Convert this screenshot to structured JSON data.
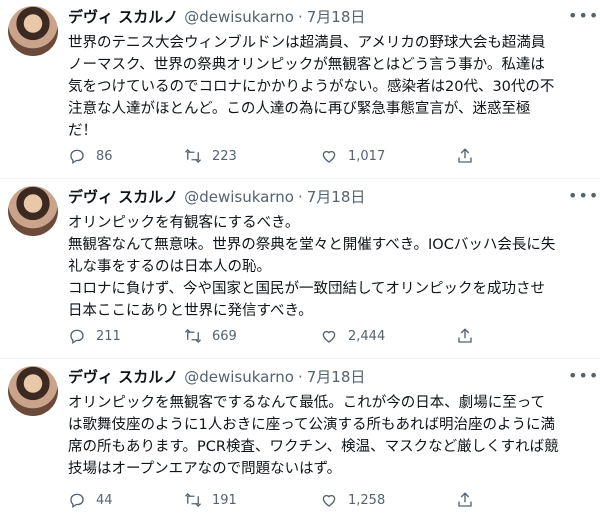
{
  "tweets": [
    {
      "name": "デヴィ スカルノ",
      "handle": "@dewisukarno",
      "separator": "·",
      "date": "7月18日",
      "lines": [
        "世界のテニス大会ウィンブルドンは超満員、アメリカの野球大会も超満員",
        "ノーマスク、世界の祭典オリンピックが無観客とはどう言う事か。私達は",
        "気をつけているのでコロナにかかりようがない。感染者は20代、30代の不",
        "注意な人達がほとんど。この人達の為に再び緊急事態宣言が、迷惑至極",
        "だ！"
      ],
      "replies": "86",
      "retweets": "223",
      "likes": "1,017"
    },
    {
      "name": "デヴィ スカルノ",
      "handle": "@dewisukarno",
      "separator": "·",
      "date": "7月18日",
      "lines": [
        "オリンピックを有観客にするべき。",
        "無観客なんて無意味。世界の祭典を堂々と開催すべき。IOCバッハ会長に失",
        "礼な事をするのは日本人の恥。",
        "コロナに負けず、今や国家と国民が一致団結してオリンピックを成功させ",
        "日本ここにありと世界に発信すべき。"
      ],
      "replies": "211",
      "retweets": "669",
      "likes": "2,444"
    },
    {
      "name": "デヴィ スカルノ",
      "handle": "@dewisukarno",
      "separator": "·",
      "date": "7月18日",
      "lines": [
        "オリンピックを無観客でするなんて最低。これが今の日本、劇場に至って",
        "は歌舞伎座のように1人おきに座って公演する所もあれば明治座のように満",
        "席の所もあります。PCR検査、ワクチン、検温、マスクなど厳しくすれば競",
        "技場はオープンエアなので問題ないはず。"
      ],
      "replies": "44",
      "retweets": "191",
      "likes": "1,258"
    }
  ],
  "icons": {
    "reply": "reply-icon",
    "retweet": "retweet-icon",
    "like": "heart-icon",
    "share": "share-icon",
    "more": "more-icon"
  }
}
